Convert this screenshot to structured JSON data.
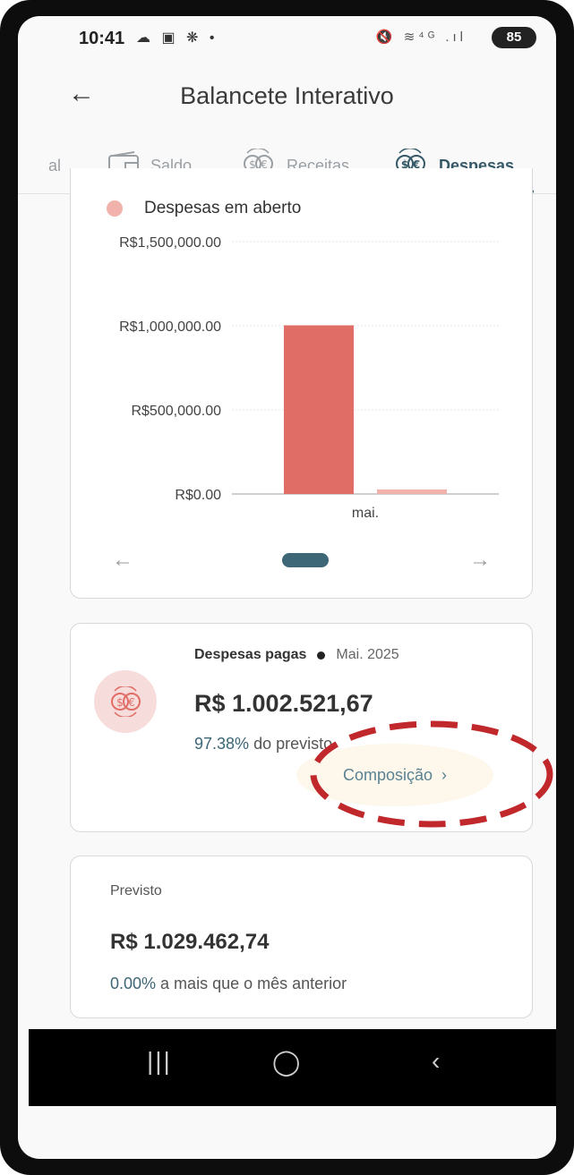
{
  "status_bar": {
    "time": "10:41",
    "left_icons": "☁ ▣ ❋ •",
    "right_icons": "🔇 ≋⁴ᴳ .ıl",
    "battery": "85"
  },
  "app_bar": {
    "title": "Balancete Interativo",
    "back_icon": "arrow-left-icon"
  },
  "tabs": [
    {
      "label": "al",
      "icon": "none",
      "active": false
    },
    {
      "label": "Saldo",
      "icon": "wallet-icon",
      "active": false
    },
    {
      "label": "Receitas",
      "icon": "currency-exchange-icon",
      "active": false
    },
    {
      "label": "Despesas",
      "icon": "currency-exchange-icon",
      "active": true
    }
  ],
  "chart": {
    "legend_label": "Despesas em aberto",
    "legend_color": "#f1b2ac",
    "bar_color_primary": "#e06e67",
    "bar_color_secondary": "#f1b2ac"
  },
  "chart_data": {
    "type": "bar",
    "categories": [
      "mai."
    ],
    "series": [
      {
        "values": [
          1002521.67
        ],
        "color": "#e06e67"
      },
      {
        "name": "Despesas em aberto",
        "values": [
          26941.07
        ],
        "color": "#f1b2ac"
      }
    ],
    "y_ticks": [
      "R$0.00",
      "R$500,000.00",
      "R$1,000,000.00",
      "R$1,500,000.00"
    ],
    "y_tick_values": [
      0,
      500000,
      1000000,
      1500000
    ],
    "ylim": [
      0,
      1500000
    ],
    "grid": true,
    "legend_position": "top-left"
  },
  "paid_card": {
    "title": "Despesas pagas",
    "period": "Mai. 2025",
    "amount": "R$ 1.002.521,67",
    "pct_value": "97.38%",
    "pct_suffix": " do previsto",
    "composition_label": "Composição",
    "composition_chevron": "›"
  },
  "forecast_card": {
    "label": "Previsto",
    "amount": "R$ 1.029.462,74",
    "pct_value": "0.00%",
    "pct_suffix": " a mais que o mês anterior"
  },
  "nav_bar": {
    "recent": "|||",
    "home": "◯",
    "back": "‹"
  },
  "annotation_color": "#c0282b"
}
